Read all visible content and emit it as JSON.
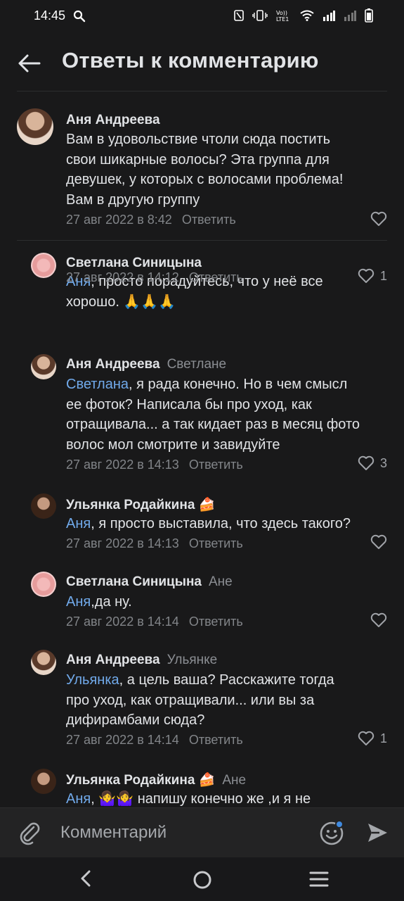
{
  "status": {
    "time": "14:45"
  },
  "header": {
    "title": "Ответы к комментарию"
  },
  "comments": [
    {
      "author": "Аня Андреева",
      "reply_to": "",
      "mention": "",
      "text_lines": [
        "Вам в удовольствие чтоли сюда постить",
        "свои шикарные волосы? Эта группа для",
        "девушек, у которых с волосами проблема!",
        "Вам в другую группу"
      ],
      "date": "27 авг 2022 в 8:42",
      "reply_label": "Ответить",
      "likes": ""
    },
    {
      "author": "Светлана Синицына",
      "reply_to": "",
      "mention": "Аня",
      "text_lines": [
        ", просто порадуйтесь, что у неё все",
        "хорошо. 🙏🙏🙏"
      ],
      "date": "27 авг 2022 в 14:12",
      "reply_label": "Ответить",
      "likes": "1"
    },
    {
      "author": "Аня Андреева",
      "reply_to": "Светлане",
      "mention": "Светлана",
      "text_lines": [
        ", я рада конечно. Но в чем смысл",
        "ее фоток? Написала бы про уход, как",
        "отращивала... а так кидает раз в месяц фото",
        "волос мол смотрите и завидуйте"
      ],
      "date": "27 авг 2022 в 14:13",
      "reply_label": "Ответить",
      "likes": "3"
    },
    {
      "author": "Ульянка Родайкина 🍰",
      "reply_to": "",
      "mention": "Аня",
      "text_lines": [
        ", я просто выставила, что здесь такого?"
      ],
      "date": "27 авг 2022 в 14:13",
      "reply_label": "Ответить",
      "likes": ""
    },
    {
      "author": "Светлана Синицына",
      "reply_to": "Ане",
      "mention": "Аня",
      "text_lines": [
        ",да ну."
      ],
      "date": "27 авг 2022 в 14:14",
      "reply_label": "Ответить",
      "likes": ""
    },
    {
      "author": "Аня Андреева",
      "reply_to": "Ульянке",
      "mention": "Ульянка",
      "text_lines": [
        ", а цель ваша? Расскажите тогда",
        "про уход, как отращивали... или вы за",
        "дифирамбами сюда?"
      ],
      "date": "27 авг 2022 в 14:14",
      "reply_label": "Ответить",
      "likes": "1"
    },
    {
      "author": "Ульянка Родайкина 🍰",
      "reply_to": "Ане",
      "mention": "Аня",
      "text_lines": [
        ", 🤷‍♀️🤷‍♀️ напишу конечно же ,и я не"
      ],
      "date": "",
      "reply_label": "",
      "likes": ""
    }
  ],
  "composer": {
    "placeholder": "Комментарий"
  },
  "icons": {
    "back": "arrow-left-icon",
    "attach": "paperclip-icon",
    "emoji": "smile-icon",
    "send": "send-icon",
    "like": "heart-icon",
    "nav": [
      "nav-back-icon",
      "nav-home-icon",
      "nav-recents-icon"
    ]
  },
  "colors": {
    "background": "#19191a",
    "mention": "#71aaeb",
    "muted": "#828589",
    "composer": "#232324",
    "notification_dot": "#3f8ae0"
  }
}
